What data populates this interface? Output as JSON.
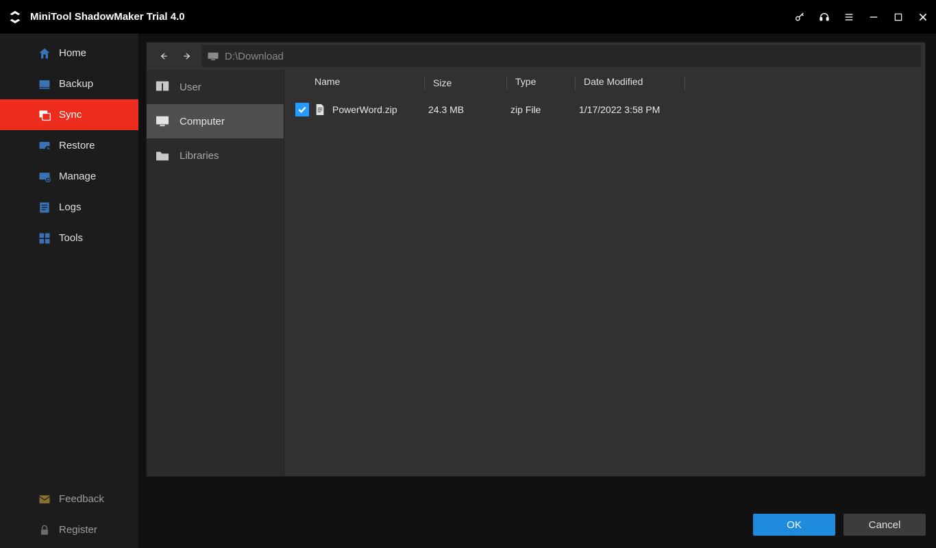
{
  "titlebar": {
    "title": "MiniTool ShadowMaker Trial 4.0"
  },
  "sidebar": {
    "items": [
      {
        "icon": "home-icon",
        "label": "Home"
      },
      {
        "icon": "backup-icon",
        "label": "Backup"
      },
      {
        "icon": "sync-icon",
        "label": "Sync",
        "active": true
      },
      {
        "icon": "restore-icon",
        "label": "Restore"
      },
      {
        "icon": "manage-icon",
        "label": "Manage"
      },
      {
        "icon": "logs-icon",
        "label": "Logs"
      },
      {
        "icon": "tools-icon",
        "label": "Tools"
      }
    ],
    "footer": [
      {
        "icon": "feedback-icon",
        "label": "Feedback"
      },
      {
        "icon": "register-icon",
        "label": "Register"
      }
    ]
  },
  "browser": {
    "path": "D:\\Download",
    "sources": [
      {
        "icon": "user-icon",
        "label": "User"
      },
      {
        "icon": "computer-icon",
        "label": "Computer",
        "selected": true
      },
      {
        "icon": "folder-icon",
        "label": "Libraries"
      }
    ],
    "columns": {
      "name": "Name",
      "size": "Size",
      "type": "Type",
      "date": "Date Modified"
    },
    "rows": [
      {
        "checked": true,
        "name": "PowerWord.zip",
        "size": "24.3 MB",
        "type": "zip File",
        "date": "1/17/2022 3:58 PM"
      }
    ]
  },
  "buttons": {
    "ok": "OK",
    "cancel": "Cancel"
  }
}
